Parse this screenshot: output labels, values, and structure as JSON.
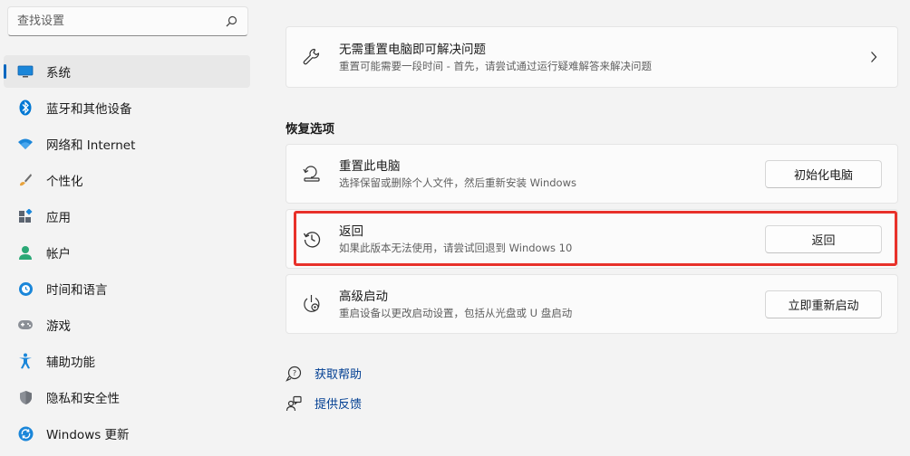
{
  "search": {
    "placeholder": "查找设置"
  },
  "sidebar": {
    "items": [
      {
        "label": "系统",
        "icon": "display-icon",
        "active": true
      },
      {
        "label": "蓝牙和其他设备",
        "icon": "bluetooth-icon"
      },
      {
        "label": "网络和 Internet",
        "icon": "wifi-icon"
      },
      {
        "label": "个性化",
        "icon": "brush-icon"
      },
      {
        "label": "应用",
        "icon": "apps-icon"
      },
      {
        "label": "帐户",
        "icon": "person-icon"
      },
      {
        "label": "时间和语言",
        "icon": "globe-clock-icon"
      },
      {
        "label": "游戏",
        "icon": "gamepad-icon"
      },
      {
        "label": "辅助功能",
        "icon": "accessibility-icon"
      },
      {
        "label": "隐私和安全性",
        "icon": "shield-icon"
      },
      {
        "label": "Windows 更新",
        "icon": "update-icon"
      }
    ]
  },
  "main": {
    "fix_card": {
      "title": "无需重置电脑即可解决问题",
      "subtitle": "重置可能需要一段时间 - 首先，请尝试通过运行疑难解答来解决问题"
    },
    "section_title": "恢复选项",
    "reset_card": {
      "title": "重置此电脑",
      "subtitle": "选择保留或删除个人文件，然后重新安装 Windows",
      "button": "初始化电脑"
    },
    "goback_card": {
      "title": "返回",
      "subtitle": "如果此版本无法使用，请尝试回退到 Windows 10",
      "button": "返回"
    },
    "advanced_card": {
      "title": "高级启动",
      "subtitle": "重启设备以更改启动设置，包括从光盘或 U 盘启动",
      "button": "立即重新启动"
    },
    "links": {
      "help": "获取帮助",
      "feedback": "提供反馈"
    }
  },
  "colors": {
    "accent": "#0067c0",
    "highlight": "#e8312a",
    "link": "#003e92"
  }
}
